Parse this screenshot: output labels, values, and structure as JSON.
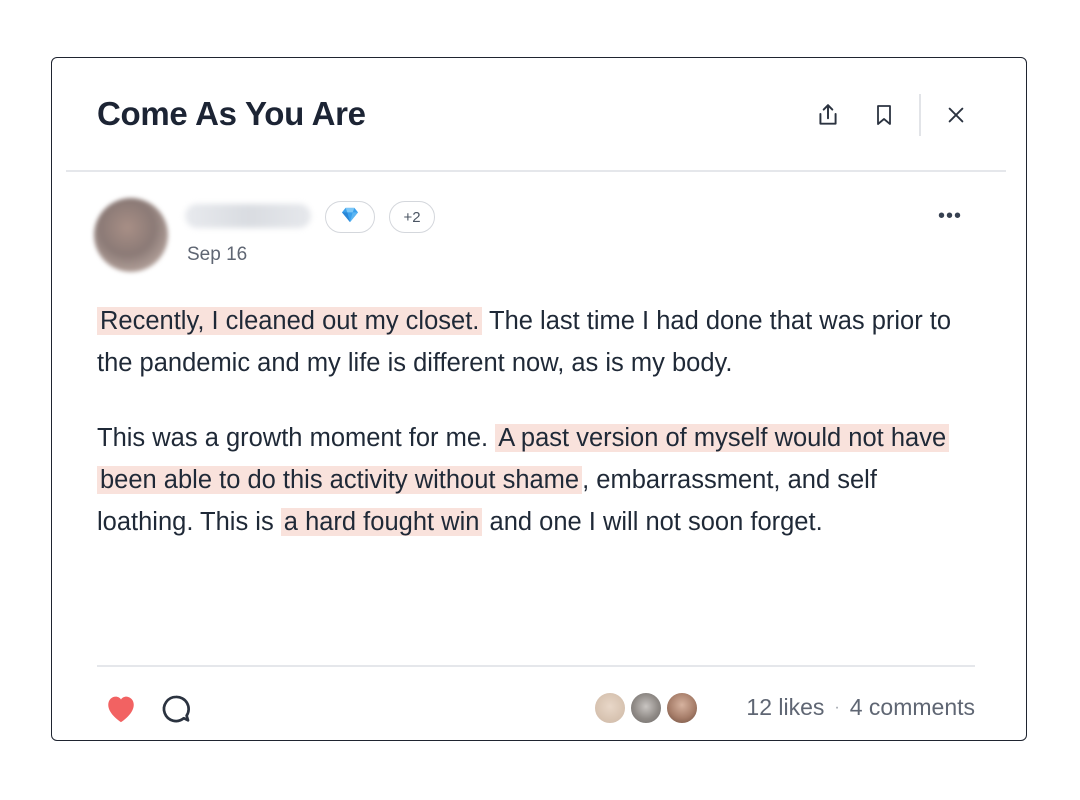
{
  "header": {
    "title": "Come As You Are",
    "share_icon": "share-icon",
    "bookmark_icon": "bookmark-icon",
    "close_icon": "close-icon"
  },
  "post": {
    "date": "Sep 16",
    "badge_icon": "diamond-icon",
    "extra_badges": "+2",
    "menu": "•••",
    "paragraph1": {
      "highlight": "Recently, I cleaned out my closet.",
      "rest": " The last time I had done that was prior to the pandemic and my life is different now, as is my body."
    },
    "paragraph2": {
      "part1": "This was a growth moment for me. ",
      "highlight1": "A past version of myself would not have been able to do this activity without shame",
      "part2": ", embarrassment, and self loathing. This is ",
      "highlight2": "a hard fought win",
      "part3": " and one I will not soon forget."
    }
  },
  "footer": {
    "likes": "12 likes",
    "separator": "·",
    "comments": "4 comments",
    "like_icon": "heart-icon",
    "comment_icon": "comment-icon"
  },
  "colors": {
    "highlight": "#f9e2dc",
    "heart": "#f26262",
    "title": "#1c2434"
  }
}
